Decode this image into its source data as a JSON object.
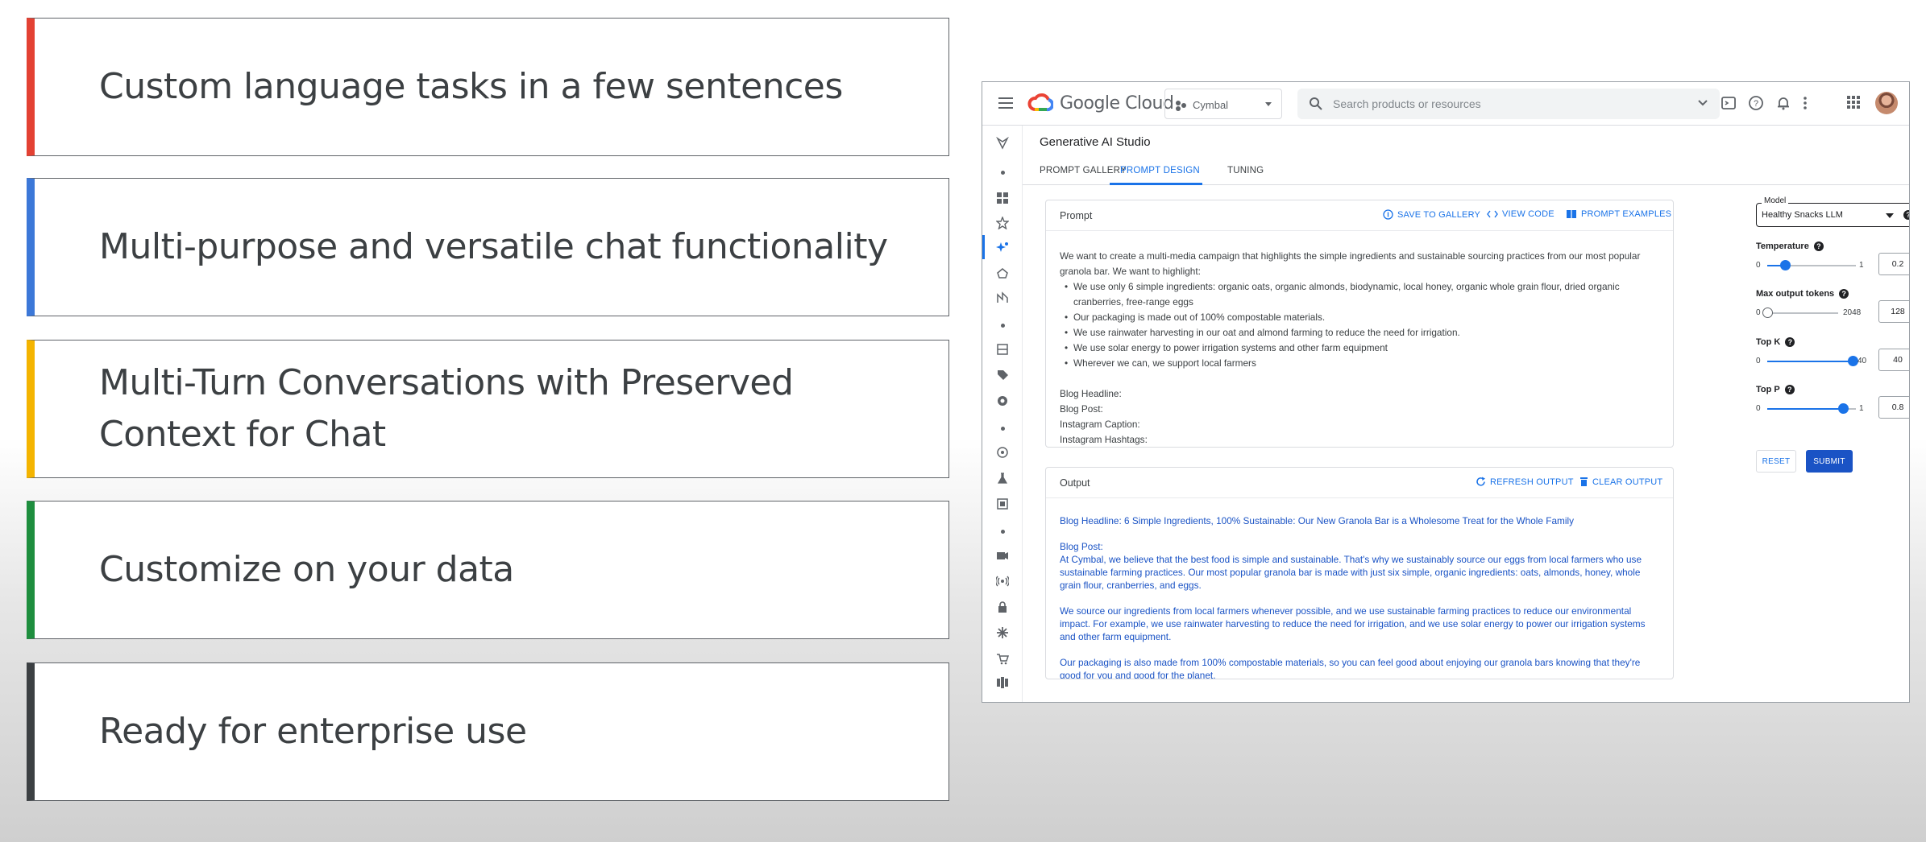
{
  "features": [
    {
      "text": "Custom language tasks in a few sentences",
      "color": "#e34133"
    },
    {
      "text": "Multi-purpose and versatile chat functionality",
      "color": "#3c78d8"
    },
    {
      "text": "Multi-Turn Conversations with Preserved Context for Chat",
      "color": "#f4b400"
    },
    {
      "text": "Customize on your data",
      "color": "#1e8e3e"
    },
    {
      "text": "Ready for enterprise use",
      "color": "#3c4043"
    }
  ],
  "console": {
    "brand": "Google Cloud",
    "project": "Cymbal",
    "search_placeholder": "Search products or resources",
    "page_title": "Generative AI Studio",
    "tabs": [
      "PROMPT GALLERY",
      "PROMPT DESIGN",
      "TUNING"
    ],
    "active_tab": "PROMPT DESIGN",
    "prompt": {
      "title": "Prompt",
      "actions": [
        "SAVE TO GALLERY",
        "VIEW CODE",
        "PROMPT EXAMPLES"
      ],
      "intro": "We want to create a multi-media campaign that highlights the simple ingredients and sustainable sourcing practices from our most popular granola bar. We want to highlight:",
      "bullets": [
        "We use only 6 simple ingredients: organic oats, organic almonds, biodynamic, local honey, organic whole grain flour, dried organic cranberries, free-range eggs",
        "Our packaging is made out of 100% compostable materials.",
        "We use rainwater harvesting in our oat and almond farming to reduce the need for irrigation.",
        "We use solar energy to power irrigation systems and other farm equipment",
        "Wherever we can, we support local farmers"
      ],
      "fields": [
        "Blog Headline:",
        "Blog Post:",
        "Instagram Caption:",
        "Instagram Hashtags:"
      ]
    },
    "output": {
      "title": "Output",
      "actions": [
        "REFRESH OUTPUT",
        "CLEAR OUTPUT"
      ],
      "headline": "Blog Headline: 6 Simple Ingredients, 100% Sustainable: Our New Granola Bar is a Wholesome Treat for the Whole Family",
      "post_label": "Blog Post:",
      "p1": "At Cymbal, we believe that the best food is simple and sustainable. That's why we sustainably source our eggs from local farmers who use sustainable farming practices. Our most popular granola bar is made with just six simple, organic ingredients: oats, almonds, honey, whole grain flour, cranberries, and eggs.",
      "p2": "We source our ingredients from local farmers whenever possible, and we use sustainable farming practices to reduce our environmental impact. For example, we use rainwater harvesting to reduce the need for irrigation, and we use solar energy to power our irrigation systems and other farm equipment.",
      "p3": "Our packaging is also made from 100% compostable materials, so you can feel good about enjoying our granola bars knowing that they're good for you and good for the planet."
    },
    "model": {
      "label": "Model",
      "value": "Healthy Snacks LLM"
    },
    "params": [
      {
        "label": "Temperature",
        "min": "0",
        "max": "1",
        "value": "0.2",
        "fraction": 0.2
      },
      {
        "label": "Max output tokens",
        "min": "0",
        "max": "2048",
        "value": "128",
        "fraction": 0.0
      },
      {
        "label": "Top K",
        "min": "0",
        "max": "40",
        "value": "40",
        "fraction": 1.0
      },
      {
        "label": "Top P",
        "min": "0",
        "max": "1",
        "value": "0.8",
        "fraction": 0.85
      }
    ],
    "buttons": {
      "reset": "RESET",
      "submit": "SUBMIT"
    }
  }
}
